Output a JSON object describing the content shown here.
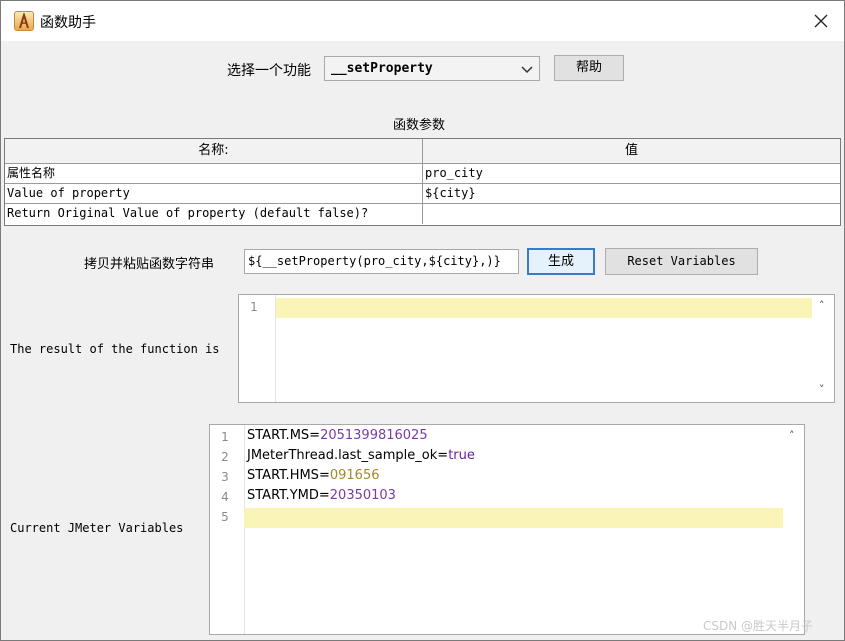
{
  "window": {
    "title": "函数助手"
  },
  "selector": {
    "label": "选择一个功能",
    "selected": "__setProperty",
    "help_label": "帮助"
  },
  "params": {
    "title": "函数参数",
    "columns": [
      "名称:",
      "值"
    ],
    "rows": [
      {
        "name": "属性名称",
        "value": "pro_city"
      },
      {
        "name": "Value of property",
        "value": "${city}"
      },
      {
        "name": "Return Original Value of property (default false)?",
        "value": ""
      }
    ]
  },
  "copy": {
    "label": "拷贝并粘贴函数字符串",
    "value": "${__setProperty(pro_city,${city},)}",
    "generate_label": "生成",
    "reset_label": "Reset Variables"
  },
  "result": {
    "label": "The result of the function is",
    "line_numbers": [
      "1"
    ]
  },
  "variables": {
    "label": "Current JMeter Variables",
    "lines": [
      {
        "num": "1",
        "key": "START.MS",
        "eq": "=",
        "val": "2051399816025"
      },
      {
        "num": "2",
        "key": "JMeterThread.last_sample_ok",
        "eq": "=",
        "val": "true"
      },
      {
        "num": "3",
        "key": "START.HMS",
        "eq": "=",
        "val": "091656"
      },
      {
        "num": "4",
        "key": "START.YMD",
        "eq": "=",
        "val": "20350103"
      },
      {
        "num": "5",
        "key": "",
        "eq": "",
        "val": ""
      }
    ]
  },
  "watermark": "CSDN @胜天半月子",
  "colors": {
    "accent": "#3a79d0",
    "highlight": "#fbf4b8",
    "value_purple": "#7a3aa6",
    "value_olive": "#a08a2a"
  }
}
